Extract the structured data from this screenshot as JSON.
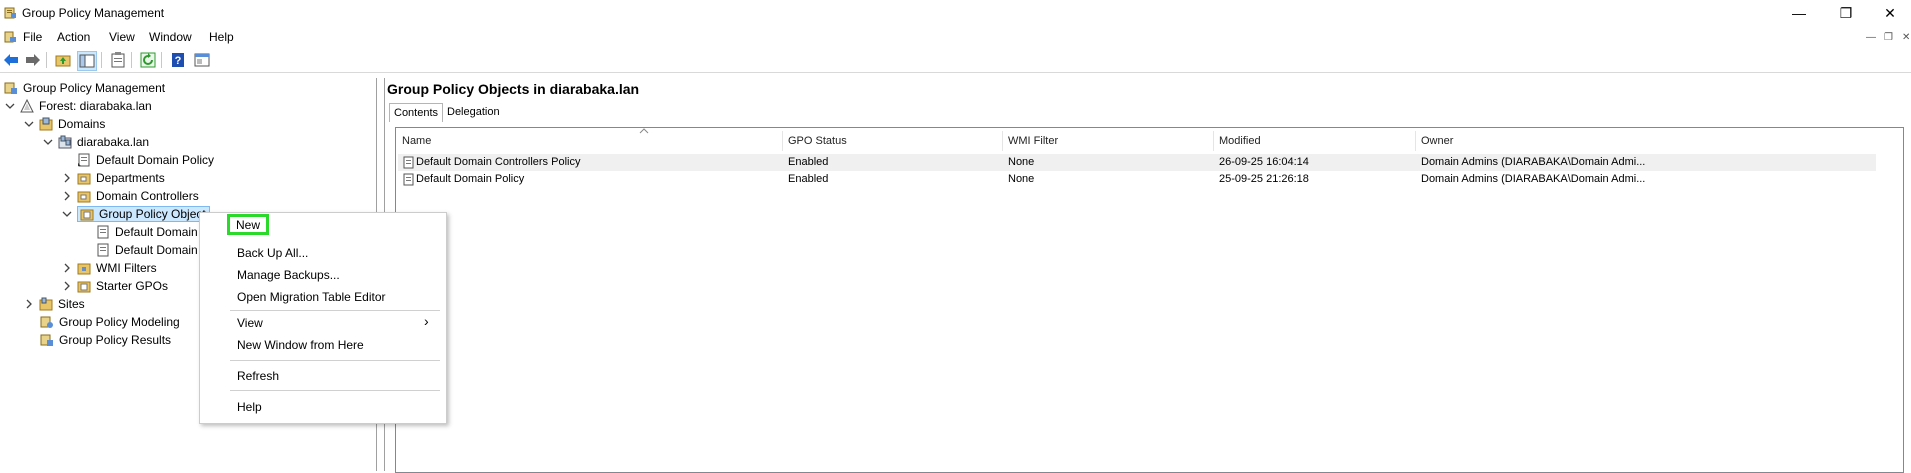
{
  "window": {
    "title": "Group Policy Management",
    "minimize": "—",
    "restore": "❐",
    "close": "✕"
  },
  "menubar": {
    "items": [
      "File",
      "Action",
      "View",
      "Window",
      "Help"
    ],
    "mdi_controls": [
      "—",
      "❐",
      "✕"
    ]
  },
  "toolbar": {
    "buttons": [
      "back-arrow-icon",
      "forward-arrow-icon",
      "up-folder-icon",
      "show-hide-tree-icon",
      "clipboard-icon",
      "refresh-icon",
      "help-icon",
      "console-icon"
    ]
  },
  "tree": {
    "root": "Group Policy Management",
    "forest": "Forest: diarabaka.lan",
    "domains": "Domains",
    "domain": "diarabaka.lan",
    "default_domain_policy": "Default Domain Policy",
    "departments": "Departments",
    "domain_controllers": "Domain Controllers",
    "gpo_folder": "Group Policy Objects",
    "gpo_child1": "Default Domain",
    "gpo_child2": "Default Domain",
    "wmi_filters": "WMI Filters",
    "starter_gpos": "Starter GPOs",
    "sites": "Sites",
    "modeling": "Group Policy Modeling",
    "results": "Group Policy Results"
  },
  "main": {
    "title": "Group Policy Objects in diarabaka.lan",
    "tabs": [
      "Contents",
      "Delegation"
    ],
    "columns": [
      "Name",
      "GPO Status",
      "WMI Filter",
      "Modified",
      "Owner"
    ],
    "rows": [
      [
        "Default Domain Controllers Policy",
        "Enabled",
        "None",
        "26-09-25 16:04:14",
        "Domain Admins (DIARABAKA\\Domain Admi..."
      ],
      [
        "Default Domain Policy",
        "Enabled",
        "None",
        "25-09-25 21:26:18",
        "Domain Admins (DIARABAKA\\Domain Admi..."
      ]
    ]
  },
  "context_menu": {
    "new": "New",
    "backup_all": "Back Up All...",
    "manage_backups": "Manage Backups...",
    "migration_editor": "Open Migration Table Editor",
    "view": "View",
    "new_window": "New Window from Here",
    "refresh": "Refresh",
    "help": "Help",
    "submenu_arrow": "›"
  },
  "colors": {
    "highlight": "#2bd92b",
    "selection": "#cce8ff",
    "accent_blue": "#1e6fd9"
  }
}
